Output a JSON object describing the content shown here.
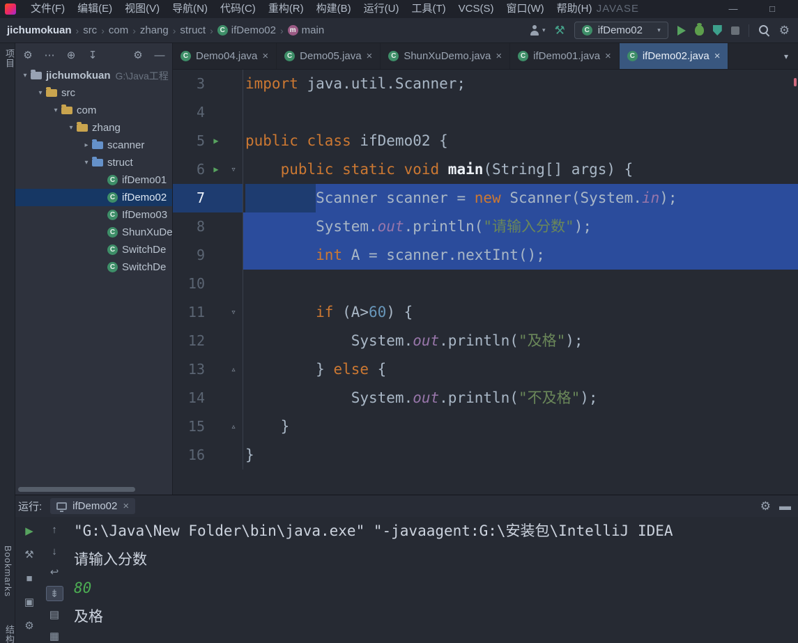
{
  "icons": {
    "class_letter": "C",
    "method_letter": "m",
    "gear": "⚙",
    "minimize": "—",
    "maximize": "□",
    "close": "×",
    "chevron_expanded": "▾",
    "chevron_collapsed": "▸",
    "fold_open": "▿",
    "fold_close": "▵",
    "run_arrow": "▶"
  },
  "colors": {
    "selection": "#2b4c9c",
    "selection_gutter": "#1e3c70",
    "keyword": "#cc7832",
    "string": "#6a8759",
    "field": "#9876aa",
    "number": "#6897bb",
    "run_green": "#57a35f",
    "tab_active": "#39577f",
    "tree_selected": "#163764"
  },
  "titlebar": {
    "app_title": "JAVASE",
    "menus": [
      "文件(F)",
      "编辑(E)",
      "视图(V)",
      "导航(N)",
      "代码(C)",
      "重构(R)",
      "构建(B)",
      "运行(U)",
      "工具(T)",
      "VCS(S)",
      "窗口(W)",
      "帮助(H)"
    ]
  },
  "navbar": {
    "separator": "›",
    "breadcrumbs": [
      {
        "label": "jichumokuan",
        "bold": true
      },
      {
        "label": "src"
      },
      {
        "label": "com"
      },
      {
        "label": "zhang"
      },
      {
        "label": "struct"
      },
      {
        "label": "ifDemo02",
        "icon": "class"
      },
      {
        "label": "main",
        "icon": "method"
      }
    ],
    "run_config": {
      "label": "ifDemo02",
      "caret": "▾"
    }
  },
  "left_strip": {
    "top_label": "项目",
    "bookmarks_label": "Bookmarks",
    "bottom_label": "结构"
  },
  "project_panel": {
    "toolbar": [
      {
        "name": "panel-menu-gear-icon",
        "glyph": "⚙"
      },
      {
        "name": "panel-more-icon",
        "glyph": "⋯"
      },
      {
        "name": "locate-file-icon",
        "glyph": "⊕"
      },
      {
        "name": "collapse-all-icon",
        "glyph": "↧"
      },
      {
        "name": "spacer",
        "spacer": true
      },
      {
        "name": "panel-settings-gear-icon",
        "glyph": "⚙"
      },
      {
        "name": "hide-panel-icon",
        "glyph": "—"
      }
    ],
    "tree": [
      {
        "depth": 0,
        "chevron": "v",
        "icon": "folder",
        "color": "#98a2b3",
        "label": "jichumokuan",
        "suffix": "G:\\Java工程",
        "bold": true
      },
      {
        "depth": 1,
        "chevron": "v",
        "icon": "folder",
        "color": "#c9a44e",
        "label": "src"
      },
      {
        "depth": 2,
        "chevron": "v",
        "icon": "folder",
        "color": "#c9a44e",
        "label": "com"
      },
      {
        "depth": 3,
        "chevron": "v",
        "icon": "folder",
        "color": "#c9a44e",
        "label": "zhang"
      },
      {
        "depth": 4,
        "chevron": ">",
        "icon": "folder",
        "color": "#6591c9",
        "label": "scanner"
      },
      {
        "depth": 4,
        "chevron": "v",
        "icon": "folder",
        "color": "#6591c9",
        "label": "struct"
      },
      {
        "depth": 5,
        "icon": "class",
        "label": "ifDemo01"
      },
      {
        "depth": 5,
        "icon": "class",
        "label": "ifDemo02",
        "selected": true
      },
      {
        "depth": 5,
        "icon": "class",
        "label": "IfDemo03"
      },
      {
        "depth": 5,
        "icon": "class",
        "label": "ShunXuDe"
      },
      {
        "depth": 5,
        "icon": "class",
        "label": "SwitchDe"
      },
      {
        "depth": 5,
        "icon": "class",
        "label": "SwitchDe"
      }
    ]
  },
  "editor": {
    "tabs": [
      {
        "label": "Demo04.java"
      },
      {
        "label": "Demo05.java"
      },
      {
        "label": "ShunXuDemo.java"
      },
      {
        "label": "ifDemo01.java"
      },
      {
        "label": "ifDemo02.java",
        "active": true
      }
    ],
    "overflow_glyph": "▾",
    "lines": [
      {
        "num": 3,
        "tokens": [
          {
            "t": "import",
            "c": "k"
          },
          {
            "t": " java.util.Scanner;",
            "c": "d"
          }
        ]
      },
      {
        "num": 4,
        "tokens": []
      },
      {
        "num": 5,
        "run": true,
        "tokens": [
          {
            "t": "public class",
            "c": "k"
          },
          {
            "t": " ifDemo02 {",
            "c": "d"
          }
        ]
      },
      {
        "num": 6,
        "run": true,
        "fold": "open",
        "tokens": [
          {
            "t": "    ",
            "c": "d"
          },
          {
            "t": "public static void ",
            "c": "k"
          },
          {
            "t": "main",
            "c": "m"
          },
          {
            "t": "(String[] args) {",
            "c": "d"
          }
        ]
      },
      {
        "num": 7,
        "sel": "part",
        "tokens": [
          {
            "t": "        ",
            "c": "d"
          },
          {
            "t": "Scanner scanner = ",
            "c": "d"
          },
          {
            "t": "new",
            "c": "k"
          },
          {
            "t": " Scanner(System.",
            "c": "d"
          },
          {
            "t": "in",
            "c": "f"
          },
          {
            "t": ");",
            "c": "d"
          }
        ]
      },
      {
        "num": 8,
        "sel": "full",
        "tokens": [
          {
            "t": "        System.",
            "c": "d"
          },
          {
            "t": "out",
            "c": "f"
          },
          {
            "t": ".println(",
            "c": "d"
          },
          {
            "t": "\"请输入分数\"",
            "c": "s"
          },
          {
            "t": ");",
            "c": "d"
          }
        ]
      },
      {
        "num": 9,
        "sel": "full",
        "tokens": [
          {
            "t": "        ",
            "c": "d"
          },
          {
            "t": "int",
            "c": "k"
          },
          {
            "t": " A = scanner.nextInt();",
            "c": "d"
          }
        ]
      },
      {
        "num": 10,
        "tokens": []
      },
      {
        "num": 11,
        "fold": "open",
        "tokens": [
          {
            "t": "        ",
            "c": "d"
          },
          {
            "t": "if",
            "c": "k"
          },
          {
            "t": " (A>",
            "c": "d"
          },
          {
            "t": "60",
            "c": "n"
          },
          {
            "t": ") {",
            "c": "d"
          }
        ]
      },
      {
        "num": 12,
        "tokens": [
          {
            "t": "            System.",
            "c": "d"
          },
          {
            "t": "out",
            "c": "f"
          },
          {
            "t": ".println(",
            "c": "d"
          },
          {
            "t": "\"及格\"",
            "c": "s"
          },
          {
            "t": ");",
            "c": "d"
          }
        ]
      },
      {
        "num": 13,
        "fold": "close",
        "tokens": [
          {
            "t": "        } ",
            "c": "d"
          },
          {
            "t": "else",
            "c": "k"
          },
          {
            "t": " {",
            "c": "d"
          }
        ]
      },
      {
        "num": 14,
        "tokens": [
          {
            "t": "            System.",
            "c": "d"
          },
          {
            "t": "out",
            "c": "f"
          },
          {
            "t": ".println(",
            "c": "d"
          },
          {
            "t": "\"不及格\"",
            "c": "s"
          },
          {
            "t": ");",
            "c": "d"
          }
        ]
      },
      {
        "num": 15,
        "fold": "close",
        "tokens": [
          {
            "t": "    }",
            "c": "d"
          }
        ]
      },
      {
        "num": 16,
        "tokens": [
          {
            "t": "}",
            "c": "d"
          }
        ]
      }
    ]
  },
  "run_panel": {
    "title": "运行:",
    "tab_label": "ifDemo02",
    "header_icons": [
      {
        "name": "run-settings-gear-icon",
        "glyph": "⚙"
      },
      {
        "name": "hide-panel-icon",
        "glyph": "▬"
      }
    ],
    "toolbar_col1": [
      {
        "name": "rerun-button",
        "glyph": "▶",
        "green": true
      },
      {
        "name": "build-tool-icon",
        "glyph": "⚒"
      },
      {
        "name": "stop-button",
        "glyph": "■"
      },
      {
        "name": "screenshot-icon",
        "glyph": "▣"
      },
      {
        "name": "run-gear-icon",
        "glyph": "⚙"
      }
    ],
    "toolbar_col2": [
      {
        "name": "up-stack-trace-icon",
        "glyph": "↑"
      },
      {
        "name": "down-stack-trace-icon",
        "glyph": "↓"
      },
      {
        "name": "soft-wrap-icon",
        "glyph": "↩"
      },
      {
        "name": "scroll-to-end-icon",
        "glyph": "⇟",
        "selected": true
      },
      {
        "name": "print-icon",
        "glyph": "▤"
      },
      {
        "name": "clear-icon",
        "glyph": "▦"
      }
    ],
    "console": [
      {
        "style": "cmd",
        "text": "\"G:\\Java\\New Folder\\bin\\java.exe\" \"-javaagent:G:\\安装包\\IntelliJ IDEA"
      },
      {
        "style": "out",
        "text": "请输入分数"
      },
      {
        "style": "input",
        "text": "80"
      },
      {
        "style": "out",
        "text": "及格"
      }
    ]
  }
}
